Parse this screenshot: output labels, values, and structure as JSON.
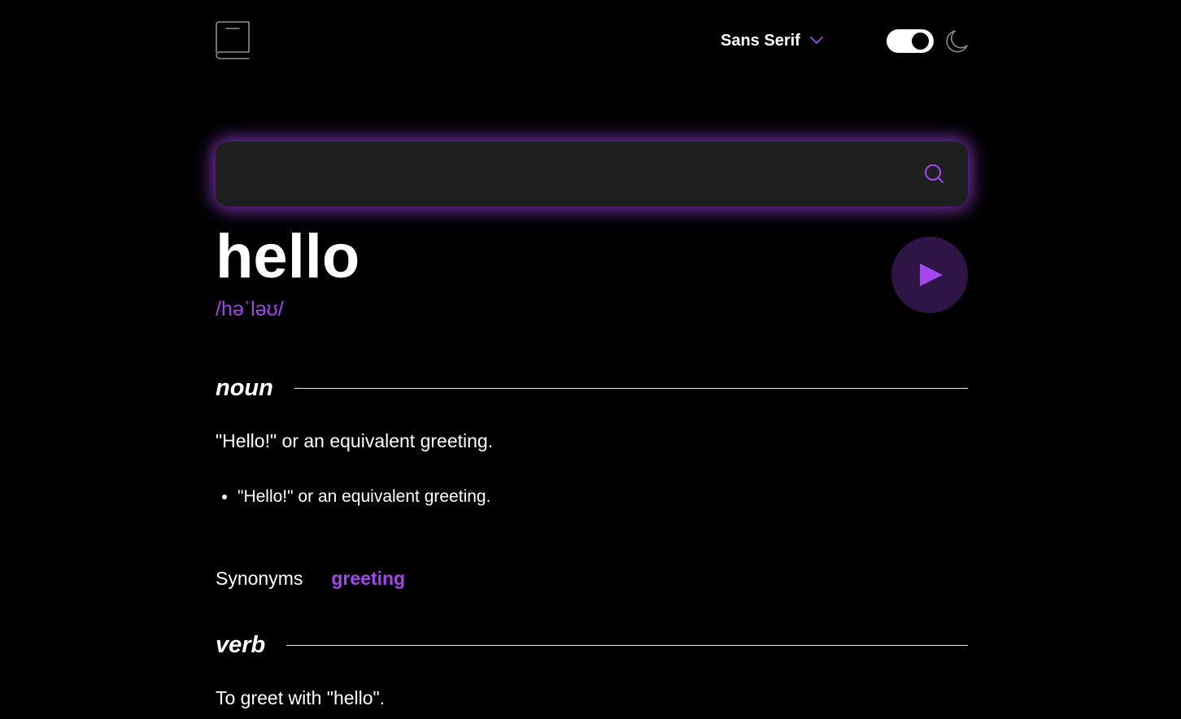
{
  "header": {
    "logo_icon": "book-icon",
    "font_select": {
      "selected": "Sans Serif",
      "icon": "chevron-down-icon"
    },
    "theme_toggle": {
      "state": "dark"
    },
    "theme_icon": "moon-icon"
  },
  "search": {
    "value": "",
    "placeholder": "",
    "icon": "search-icon"
  },
  "entry": {
    "word": "hello",
    "phonetic": "/həˈləʊ/",
    "play_icon": "play-icon"
  },
  "meanings": [
    {
      "part_of_speech": "noun",
      "definition": "\"Hello!\" or an equivalent greeting.",
      "bullets": [
        "\"Hello!\" or an equivalent greeting."
      ],
      "synonyms_label": "Synonyms",
      "synonyms": [
        "greeting"
      ]
    },
    {
      "part_of_speech": "verb",
      "definition": "To greet with \"hello\"."
    }
  ],
  "colors": {
    "accent": "#a445ed",
    "background": "#000000",
    "search_bg": "#1f1f1f",
    "text": "#ffffff",
    "play_bg": "#2e1545"
  }
}
